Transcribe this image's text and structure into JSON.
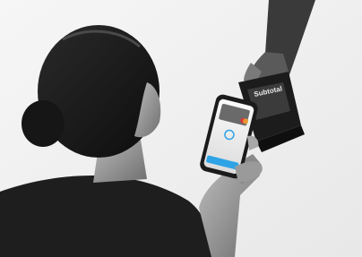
{
  "scene": {
    "image_kind": "photograph",
    "colors": {
      "background": "#f1f1f1",
      "phone_screen_accent": "#2ea3e6",
      "card_accent": "#d63a3a"
    }
  },
  "terminal": {
    "screen_text": "Subtotal"
  }
}
